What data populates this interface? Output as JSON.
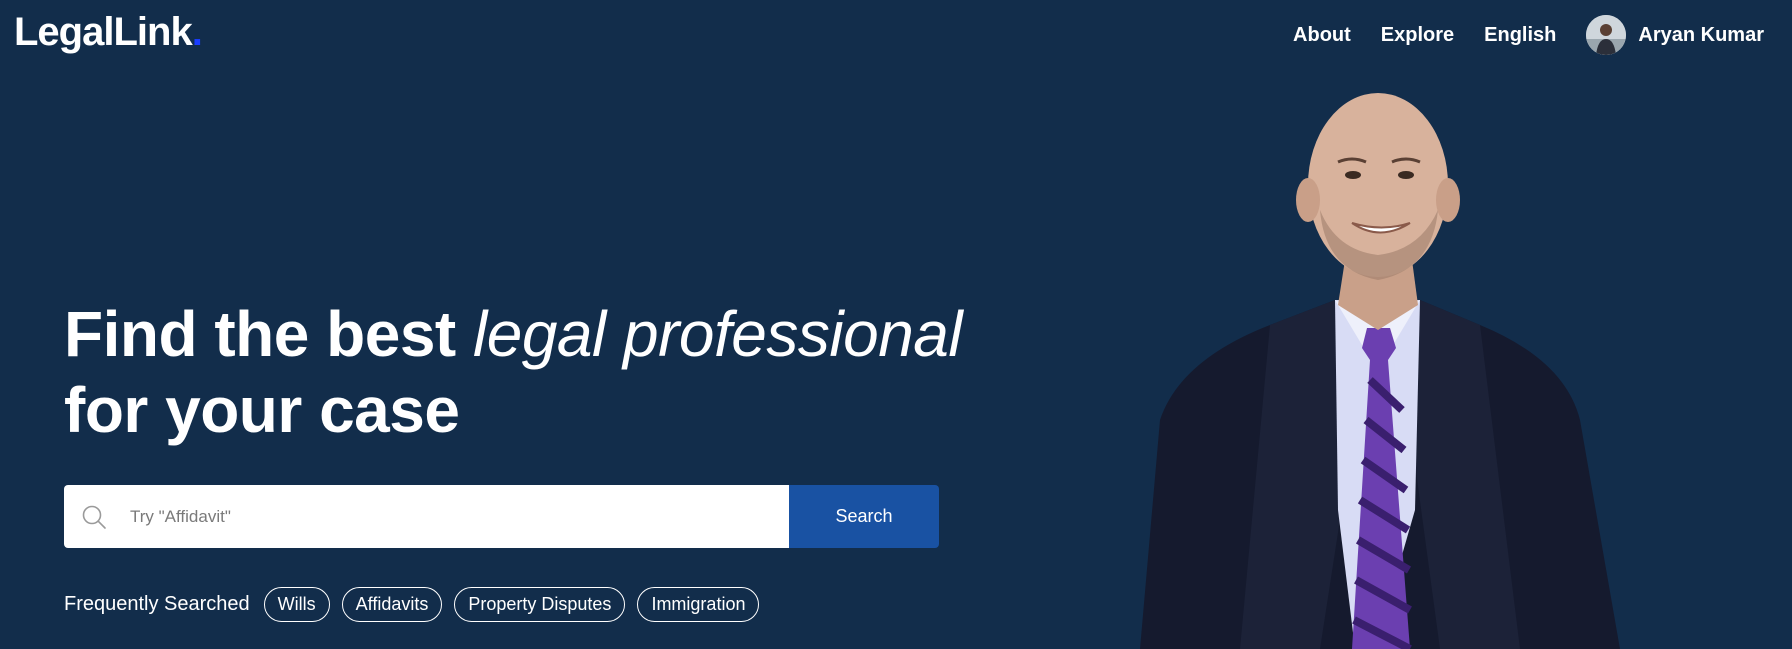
{
  "brand": {
    "name": "LegalLink",
    "dot": "."
  },
  "nav": {
    "links": [
      "About",
      "Explore",
      "English"
    ],
    "user_name": "Aryan Kumar"
  },
  "hero": {
    "title_bold": "Find the best ",
    "title_italic": "legal professional",
    "title_line2": "for your case"
  },
  "search": {
    "placeholder": "Try \"Affidavit\"",
    "value": "",
    "button_label": "Search"
  },
  "frequently_searched": {
    "label": "Frequently Searched",
    "chips": [
      "Wills",
      "Affidavits",
      "Property Disputes",
      "Immigration"
    ]
  },
  "colors": {
    "background": "#122d4b",
    "accent": "#1952a3",
    "logo_dot": "#1a3dff"
  }
}
